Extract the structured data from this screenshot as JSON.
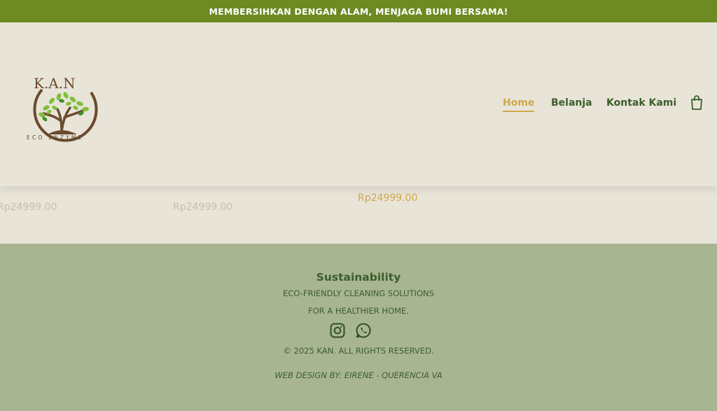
{
  "announcement": {
    "text": "MEMBERSIHKAN DENGAN ALAM, MENJAGA BUMI BERSAMA!"
  },
  "logo": {
    "letters": "K.A.N",
    "tagline": "ECO ENZYME"
  },
  "nav": {
    "items": [
      {
        "label": "Home",
        "active": true
      },
      {
        "label": "Belanja",
        "active": false
      },
      {
        "label": "Kontak Kami",
        "active": false
      }
    ],
    "cart_icon": "shopping-bag-icon"
  },
  "products": {
    "prices": [
      "Rp24999.00",
      "Rp24999.00",
      "Rp24999.00"
    ]
  },
  "footer": {
    "title": "Sustainability",
    "line1": "ECO-FRIENDLY CLEANING SOLUTIONS",
    "line2": "FOR A HEALTHIER HOME.",
    "socials": [
      "instagram-icon",
      "whatsapp-icon"
    ],
    "copyright": "© 2025 KAN. ALL RIGHTS RESERVED.",
    "credit": "WEB DESIGN BY: EIRENE - QUERENCIA VA"
  },
  "colors": {
    "announcement_bg": "#6e8a22",
    "page_bg": "#e8e4d8",
    "footer_bg": "#a8b592",
    "accent": "#d0a84a",
    "text_green": "#3b5e2b"
  }
}
